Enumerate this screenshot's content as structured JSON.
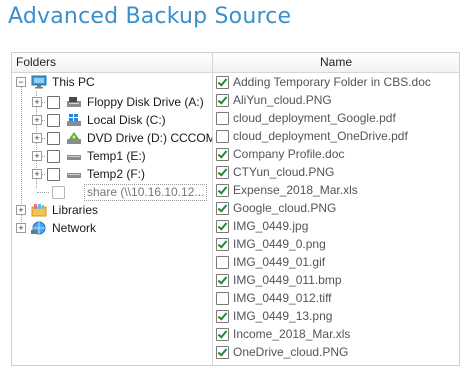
{
  "title": "Advanced Backup Source",
  "folders_header": "Folders",
  "name_header": "Name",
  "tree": {
    "this_pc": "This PC",
    "drives": [
      {
        "label": "Floppy Disk Drive (A:)",
        "icon": "floppy-drive-icon"
      },
      {
        "label": "Local Disk (C:)",
        "icon": "local-disk-icon"
      },
      {
        "label": "DVD Drive (D:) CCCOMA",
        "icon": "dvd-drive-icon"
      },
      {
        "label": "Temp1 (E:)",
        "icon": "drive-icon"
      },
      {
        "label": "Temp2 (F:)",
        "icon": "drive-icon"
      }
    ],
    "share": "share (\\\\10.16.10.12...",
    "libraries": "Libraries",
    "network": "Network"
  },
  "files": [
    {
      "name": "Adding Temporary Folder in CBS.doc",
      "checked": true
    },
    {
      "name": "AliYun_cloud.PNG",
      "checked": true
    },
    {
      "name": "cloud_deployment_Google.pdf",
      "checked": false
    },
    {
      "name": "cloud_deployment_OneDrive.pdf",
      "checked": false
    },
    {
      "name": "Company Profile.doc",
      "checked": true
    },
    {
      "name": "CTYun_cloud.PNG",
      "checked": true
    },
    {
      "name": "Expense_2018_Mar.xls",
      "checked": true
    },
    {
      "name": "Google_cloud.PNG",
      "checked": true
    },
    {
      "name": "IMG_0449.jpg",
      "checked": true
    },
    {
      "name": "IMG_0449_0.png",
      "checked": true
    },
    {
      "name": "IMG_0449_01.gif",
      "checked": false
    },
    {
      "name": "IMG_0449_011.bmp",
      "checked": true
    },
    {
      "name": "IMG_0449_012.tiff",
      "checked": false
    },
    {
      "name": "IMG_0449_13.png",
      "checked": true
    },
    {
      "name": "Income_2018_Mar.xls",
      "checked": true
    },
    {
      "name": "OneDrive_cloud.PNG",
      "checked": true
    }
  ]
}
